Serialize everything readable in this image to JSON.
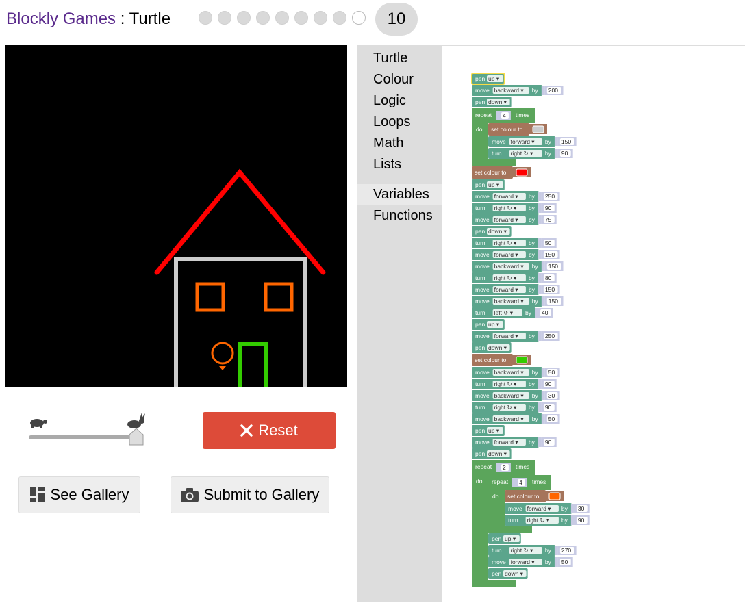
{
  "header": {
    "app": "Blockly Games",
    "separator": " : ",
    "game": "Turtle",
    "current_level": "10"
  },
  "levels": {
    "total": 10,
    "completed": 8
  },
  "speed": {
    "slow": "turtle-icon",
    "fast": "rabbit-icon",
    "value": 1.0
  },
  "buttons": {
    "reset": "Reset",
    "gallery": "See Gallery",
    "submit": "Submit to Gallery"
  },
  "toolbox": [
    "Turtle",
    "Colour",
    "Logic",
    "Loops",
    "Math",
    "Lists",
    "Variables",
    "Functions"
  ],
  "toolbox_selected": "Variables",
  "colors": {
    "turtle": "#5ba58c",
    "colour": "#a5745b",
    "loop": "#5ba55b",
    "number": "#c8cbe4",
    "header_purple": "#5a2a8c",
    "reset": "#dd4b39"
  },
  "program": [
    {
      "k": "pen",
      "v": "up",
      "selected": true
    },
    {
      "k": "move",
      "v": "backward",
      "n": "200"
    },
    {
      "k": "pen",
      "v": "down"
    },
    {
      "k": "repeat",
      "n": "4",
      "do": [
        {
          "k": "colour",
          "c": "#cccccc"
        },
        {
          "k": "move",
          "v": "forward",
          "n": "150"
        },
        {
          "k": "turn",
          "v": "right ↻",
          "n": "90"
        }
      ]
    },
    {
      "k": "colour",
      "c": "#ff0000"
    },
    {
      "k": "pen",
      "v": "up"
    },
    {
      "k": "move",
      "v": "forward",
      "n": "250"
    },
    {
      "k": "turn",
      "v": "right ↻",
      "n": "90"
    },
    {
      "k": "move",
      "v": "forward",
      "n": "75"
    },
    {
      "k": "pen",
      "v": "down"
    },
    {
      "k": "turn",
      "v": "right ↻",
      "n": "50"
    },
    {
      "k": "move",
      "v": "forward",
      "n": "150"
    },
    {
      "k": "move",
      "v": "backward",
      "n": "150"
    },
    {
      "k": "turn",
      "v": "right ↻",
      "n": "80"
    },
    {
      "k": "move",
      "v": "forward",
      "n": "150"
    },
    {
      "k": "move",
      "v": "backward",
      "n": "150"
    },
    {
      "k": "turn",
      "v": "left ↺",
      "n": "40"
    },
    {
      "k": "pen",
      "v": "up"
    },
    {
      "k": "move",
      "v": "forward",
      "n": "250"
    },
    {
      "k": "pen",
      "v": "down"
    },
    {
      "k": "colour",
      "c": "#33cc00"
    },
    {
      "k": "move",
      "v": "backward",
      "n": "50"
    },
    {
      "k": "turn",
      "v": "right ↻",
      "n": "90"
    },
    {
      "k": "move",
      "v": "backward",
      "n": "30"
    },
    {
      "k": "turn",
      "v": "right ↻",
      "n": "90"
    },
    {
      "k": "move",
      "v": "backward",
      "n": "50"
    },
    {
      "k": "pen",
      "v": "up"
    },
    {
      "k": "move",
      "v": "forward",
      "n": "90"
    },
    {
      "k": "pen",
      "v": "down"
    },
    {
      "k": "repeat",
      "n": "2",
      "do": [
        {
          "k": "repeat",
          "n": "4",
          "do": [
            {
              "k": "colour",
              "c": "#ff6600"
            },
            {
              "k": "move",
              "v": "forward",
              "n": "30"
            },
            {
              "k": "turn",
              "v": "right ↻",
              "n": "90"
            }
          ]
        },
        {
          "k": "pen",
          "v": "up"
        },
        {
          "k": "turn",
          "v": "right ↻",
          "n": "270"
        },
        {
          "k": "move",
          "v": "forward",
          "n": "50"
        },
        {
          "k": "pen",
          "v": "down"
        }
      ]
    }
  ]
}
